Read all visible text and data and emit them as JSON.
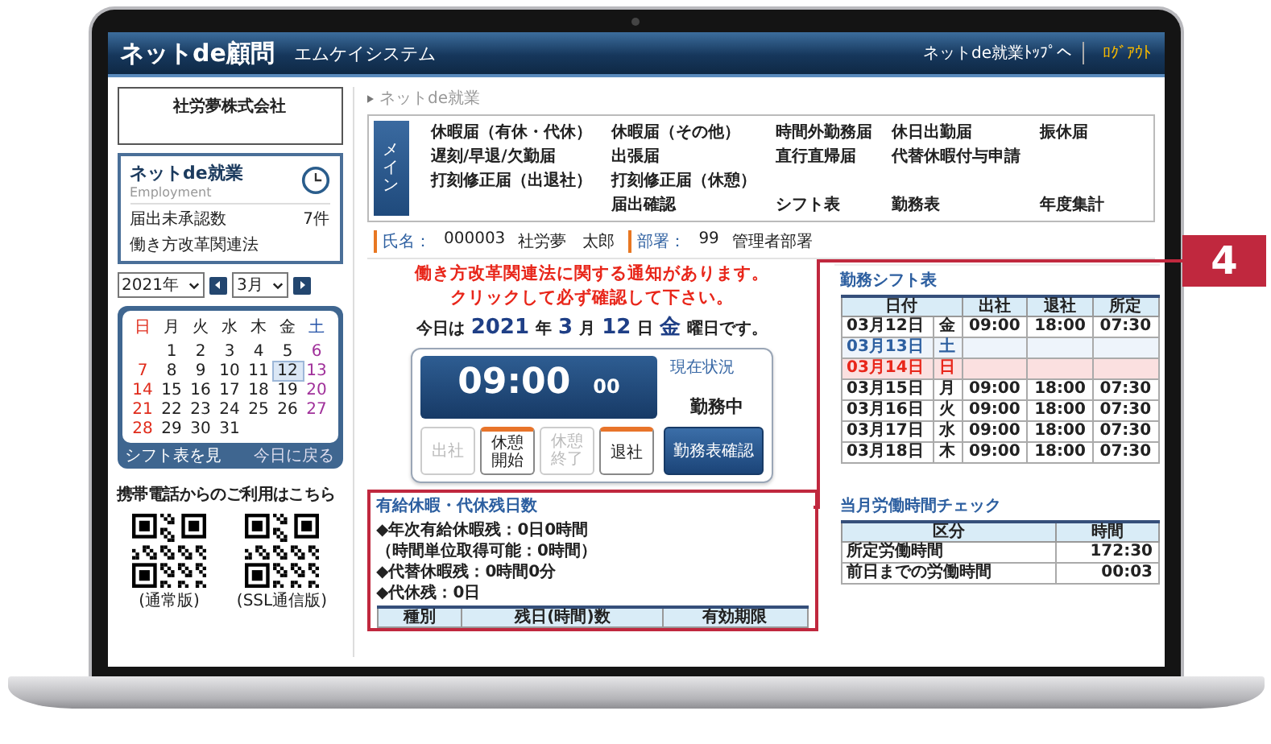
{
  "header": {
    "logo": "ネットde顧問",
    "company": "エムケイシステム",
    "top_link": "ネットde就業ﾄｯﾌﾟへ",
    "logout": "ﾛｸﾞｱｳﾄ"
  },
  "sidebar": {
    "company": "社労夢株式会社",
    "app_card": {
      "title": "ネットde就業",
      "subtitle": "Employment",
      "rows": [
        {
          "label": "届出未承認数",
          "value": "7件"
        },
        {
          "label": "働き方改革関連法"
        }
      ]
    },
    "year": "2021年",
    "month": "3月",
    "calendar": {
      "weekdays": [
        {
          "label": "日",
          "kind": "sun"
        },
        {
          "label": "月",
          "kind": "day"
        },
        {
          "label": "火",
          "kind": "day"
        },
        {
          "label": "水",
          "kind": "day"
        },
        {
          "label": "木",
          "kind": "day"
        },
        {
          "label": "金",
          "kind": "day"
        },
        {
          "label": "土",
          "kind": "sat"
        }
      ],
      "weeks": [
        {
          "leading_gap": true,
          "days": [
            {
              "day": "1",
              "selected": false
            },
            {
              "day": "2",
              "selected": false
            },
            {
              "day": "3",
              "selected": false
            },
            {
              "day": "4",
              "selected": false
            },
            {
              "day": "5",
              "selected": false
            },
            {
              "day": "6",
              "selected": false
            }
          ]
        },
        {
          "days": [
            {
              "day": "7",
              "selected": false
            },
            {
              "day": "8",
              "selected": false
            },
            {
              "day": "9",
              "selected": false
            },
            {
              "day": "10",
              "selected": false
            },
            {
              "day": "11",
              "selected": false
            },
            {
              "day": "12",
              "selected": true
            },
            {
              "day": "13",
              "selected": false
            }
          ]
        },
        {
          "days": [
            {
              "day": "14",
              "selected": false
            },
            {
              "day": "15",
              "selected": false
            },
            {
              "day": "16",
              "selected": false
            },
            {
              "day": "17",
              "selected": false
            },
            {
              "day": "18",
              "selected": false
            },
            {
              "day": "19",
              "selected": false
            },
            {
              "day": "20",
              "selected": false
            }
          ]
        },
        {
          "days": [
            {
              "day": "21",
              "selected": false
            },
            {
              "day": "22",
              "selected": false
            },
            {
              "day": "23",
              "selected": false
            },
            {
              "day": "24",
              "selected": false
            },
            {
              "day": "25",
              "selected": false
            },
            {
              "day": "26",
              "selected": false
            },
            {
              "day": "27",
              "selected": false
            }
          ]
        },
        {
          "leading_gap": false,
          "days": [
            {
              "day": "28",
              "selected": false
            },
            {
              "day": "29",
              "selected": false
            },
            {
              "day": "30",
              "selected": false
            },
            {
              "day": "31",
              "selected": false
            }
          ]
        }
      ],
      "footer_left": "シフト表を見",
      "footer_right": "今日に戻る"
    },
    "mobile_title": "携帯電話からのご利用はこちら",
    "qr_codes": [
      {
        "label": "(通常版)"
      },
      {
        "label": "(SSL通信版)"
      }
    ]
  },
  "main": {
    "breadcrumb": "ネットde就業",
    "menu_tab": "メイン",
    "menu_rows": [
      {
        "cells": [
          "休暇届（有休・代休）",
          "休暇届（その他）",
          "時間外勤務届",
          "休日出勤届",
          "振休届"
        ]
      },
      {
        "cells": [
          "遅刻/早退/欠勤届",
          "出張届",
          "直行直帰届",
          "代替休暇付与申請",
          null
        ]
      },
      {
        "cells": [
          "打刻修正届（出退社）",
          "打刻修正届（休憩）",
          null,
          null,
          null
        ]
      },
      {
        "cells": [
          null,
          "届出確認",
          "シフト表",
          "勤務表",
          "年度集計"
        ]
      }
    ],
    "user": {
      "name_label": "氏名：",
      "code": "000003",
      "name": "社労夢　太郎",
      "dept_label": "部署：",
      "dept_code": "99",
      "dept": "管理者部署"
    },
    "notice": [
      "働き方改革関連法に関する通知があります。",
      "クリックして必ず確認して下さい。"
    ],
    "date_line": [
      {
        "text": "今日は",
        "kind": "plain"
      },
      {
        "text": "2021",
        "kind": "value"
      },
      {
        "text": "年",
        "kind": "plain"
      },
      {
        "text": "3",
        "kind": "value"
      },
      {
        "text": "月",
        "kind": "plain"
      },
      {
        "text": "12",
        "kind": "value"
      },
      {
        "text": "日",
        "kind": "plain"
      },
      {
        "text": "金",
        "kind": "value"
      },
      {
        "text": "曜日です。",
        "kind": "plain"
      }
    ],
    "clock": {
      "time": "09:00",
      "seconds": "00",
      "status_label": "現在状況",
      "status": "勤務中"
    },
    "punch_buttons": [
      {
        "label": "出社",
        "disabled": true,
        "kind": "punch"
      },
      {
        "label": "休憩開始",
        "disabled": false,
        "kind": "punch"
      },
      {
        "label": "休憩終了",
        "disabled": true,
        "kind": "punch"
      },
      {
        "label": "退社",
        "disabled": false,
        "kind": "punch"
      },
      {
        "label": "勤務表確認",
        "disabled": false,
        "kind": "primary"
      }
    ],
    "shift": {
      "title": "勤務シフト表",
      "columns": [
        "日付",
        "出社",
        "退社",
        "所定"
      ],
      "rows": [
        {
          "date": "03月12日",
          "weekday": "金",
          "kind": "weekday",
          "in": "09:00",
          "out": "18:00",
          "scheduled": "07:30"
        },
        {
          "date": "03月13日",
          "weekday": "土",
          "kind": "saturday"
        },
        {
          "date": "03月14日",
          "weekday": "日",
          "kind": "sunday"
        },
        {
          "date": "03月15日",
          "weekday": "月",
          "kind": "weekday",
          "in": "09:00",
          "out": "18:00",
          "scheduled": "07:30"
        },
        {
          "date": "03月16日",
          "weekday": "火",
          "kind": "weekday",
          "in": "09:00",
          "out": "18:00",
          "scheduled": "07:30"
        },
        {
          "date": "03月17日",
          "weekday": "水",
          "kind": "weekday",
          "in": "09:00",
          "out": "18:00",
          "scheduled": "07:30"
        },
        {
          "date": "03月18日",
          "weekday": "木",
          "kind": "weekday",
          "in": "09:00",
          "out": "18:00",
          "scheduled": "07:30"
        }
      ]
    },
    "leave": {
      "title": "有給休暇・代休残日数",
      "lines": [
        {
          "text": "◆年次有給休暇残：0日0時間",
          "note": "（時間単位取得可能：0時間）"
        },
        {
          "text": "◆代替休暇残：0時間0分"
        },
        {
          "text": "◆代休残：0日"
        }
      ],
      "columns": [
        "種別",
        "残日(時間)数",
        "有効期限"
      ]
    },
    "monthly": {
      "title": "当月労働時間チェック",
      "columns": [
        "区分",
        "時間"
      ],
      "rows": [
        {
          "label": "所定労働時間",
          "value": "172:30"
        },
        {
          "label": "前日までの労働時間",
          "value": "00:03"
        }
      ]
    }
  },
  "callout": {
    "number": "4"
  }
}
